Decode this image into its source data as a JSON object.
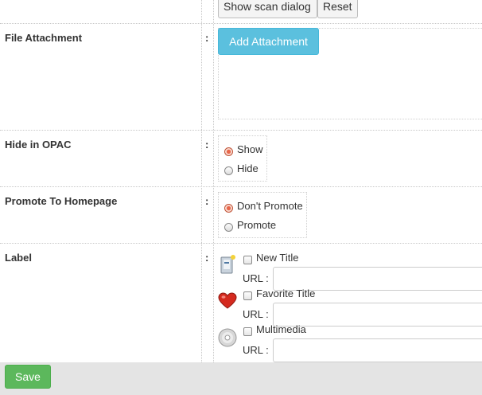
{
  "scan_row": {
    "show_scan_label": "Show scan dialog",
    "reset_label": "Reset"
  },
  "file_attachment": {
    "label": "File Attachment",
    "colon": ":",
    "button_label": "Add Attachment"
  },
  "hide_in_opac": {
    "label": "Hide in OPAC",
    "colon": ":",
    "options": [
      {
        "label": "Show",
        "selected": true
      },
      {
        "label": "Hide",
        "selected": false
      }
    ]
  },
  "promote": {
    "label": "Promote To Homepage",
    "colon": ":",
    "options": [
      {
        "label": "Don't Promote",
        "selected": true
      },
      {
        "label": "Promote",
        "selected": false
      }
    ]
  },
  "label_field": {
    "label": "Label",
    "colon": ":",
    "items": [
      {
        "icon": "new-title-icon",
        "label": "New Title",
        "checked": false,
        "url_label": "URL :",
        "url_value": ""
      },
      {
        "icon": "heart-icon",
        "label": "Favorite Title",
        "checked": false,
        "url_label": "URL :",
        "url_value": ""
      },
      {
        "icon": "cd-icon",
        "label": "Multimedia",
        "checked": false,
        "url_label": "URL :",
        "url_value": ""
      }
    ]
  },
  "footer": {
    "save_label": "Save"
  },
  "colors": {
    "info_button": "#5bc0de",
    "success_button": "#5cb85c",
    "radio_selected": "#e8664a",
    "footer_bg": "#e4e4e4"
  }
}
